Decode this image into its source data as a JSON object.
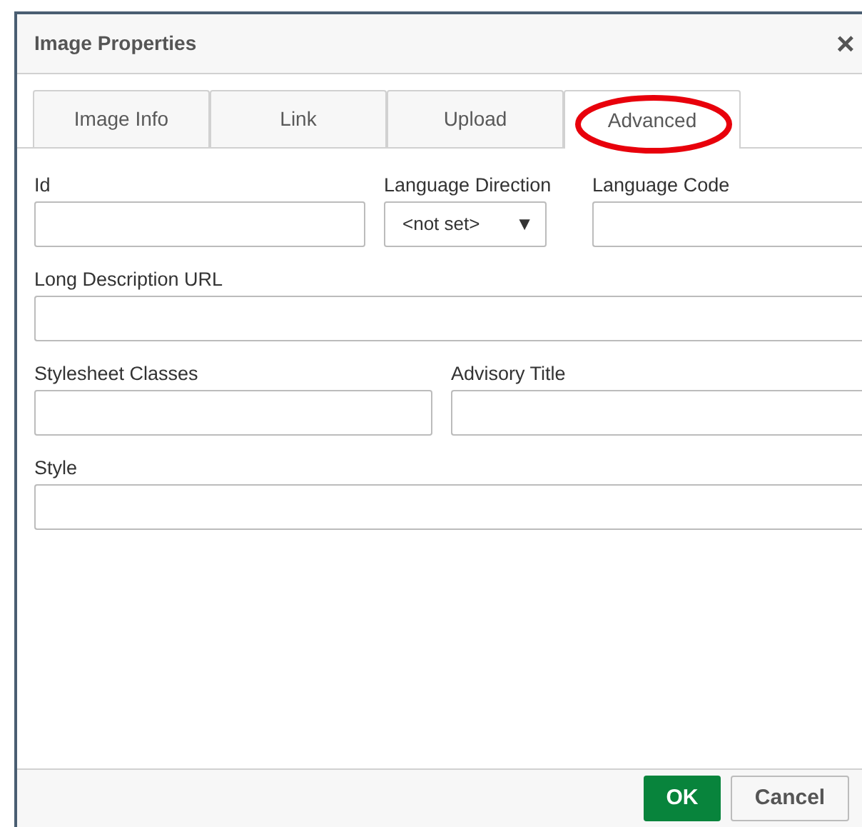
{
  "window": {
    "title": "Image Properties",
    "close": "×"
  },
  "tabs": [
    {
      "label": "Image Info",
      "selected": false,
      "circled": false
    },
    {
      "label": "Link",
      "selected": false,
      "circled": false
    },
    {
      "label": "Upload",
      "selected": false,
      "circled": false
    },
    {
      "label": "Advanced",
      "selected": true,
      "circled": true
    }
  ],
  "rows": [
    [
      {
        "label": "Id",
        "kind": "text"
      },
      {
        "label": "Language Direction",
        "kind": "select",
        "value": "<not set>",
        "arrow": "▼"
      },
      {
        "label": "Language Code",
        "kind": "text"
      }
    ],
    [
      {
        "label": "Long Description URL",
        "kind": "text"
      }
    ],
    [
      {
        "label": "Stylesheet Classes",
        "kind": "text"
      },
      {
        "label": "Advisory Title",
        "kind": "text"
      }
    ],
    [
      {
        "label": "Style",
        "kind": "text"
      }
    ]
  ],
  "buttons": [
    {
      "label": "OK",
      "kind": "primary"
    },
    {
      "label": "Cancel",
      "kind": "secondary"
    }
  ]
}
